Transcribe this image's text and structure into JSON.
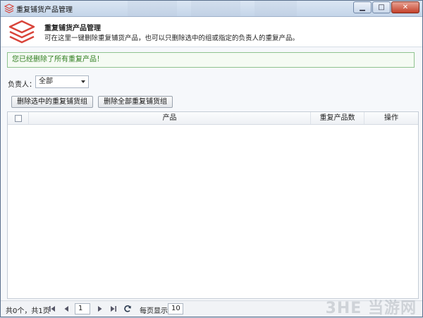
{
  "window": {
    "title": "重复铺货产品管理"
  },
  "header": {
    "title": "重复铺货产品管理",
    "description": "可在这里一键删除重复铺货产品，也可以只删除选中的组或指定的负责人的重复产品。"
  },
  "notice": {
    "text": "您已经删除了所有重复产品！"
  },
  "filter": {
    "label": "负责人：",
    "selected": "全部"
  },
  "buttons": {
    "delete_selected": "删除选中的重复铺货组",
    "delete_all": "删除全部重复铺货组"
  },
  "table": {
    "columns": [
      "产品",
      "重复产品数",
      "操作"
    ]
  },
  "pager": {
    "summary": "共0个，共1页",
    "current_page": "1",
    "page_size_label": "每页显示:",
    "page_size": "10"
  },
  "watermark": "3HE 当游网",
  "colors": {
    "accent": "#d9443a",
    "notice_border": "#8fc38f",
    "notice_text": "#2f7d1f"
  }
}
